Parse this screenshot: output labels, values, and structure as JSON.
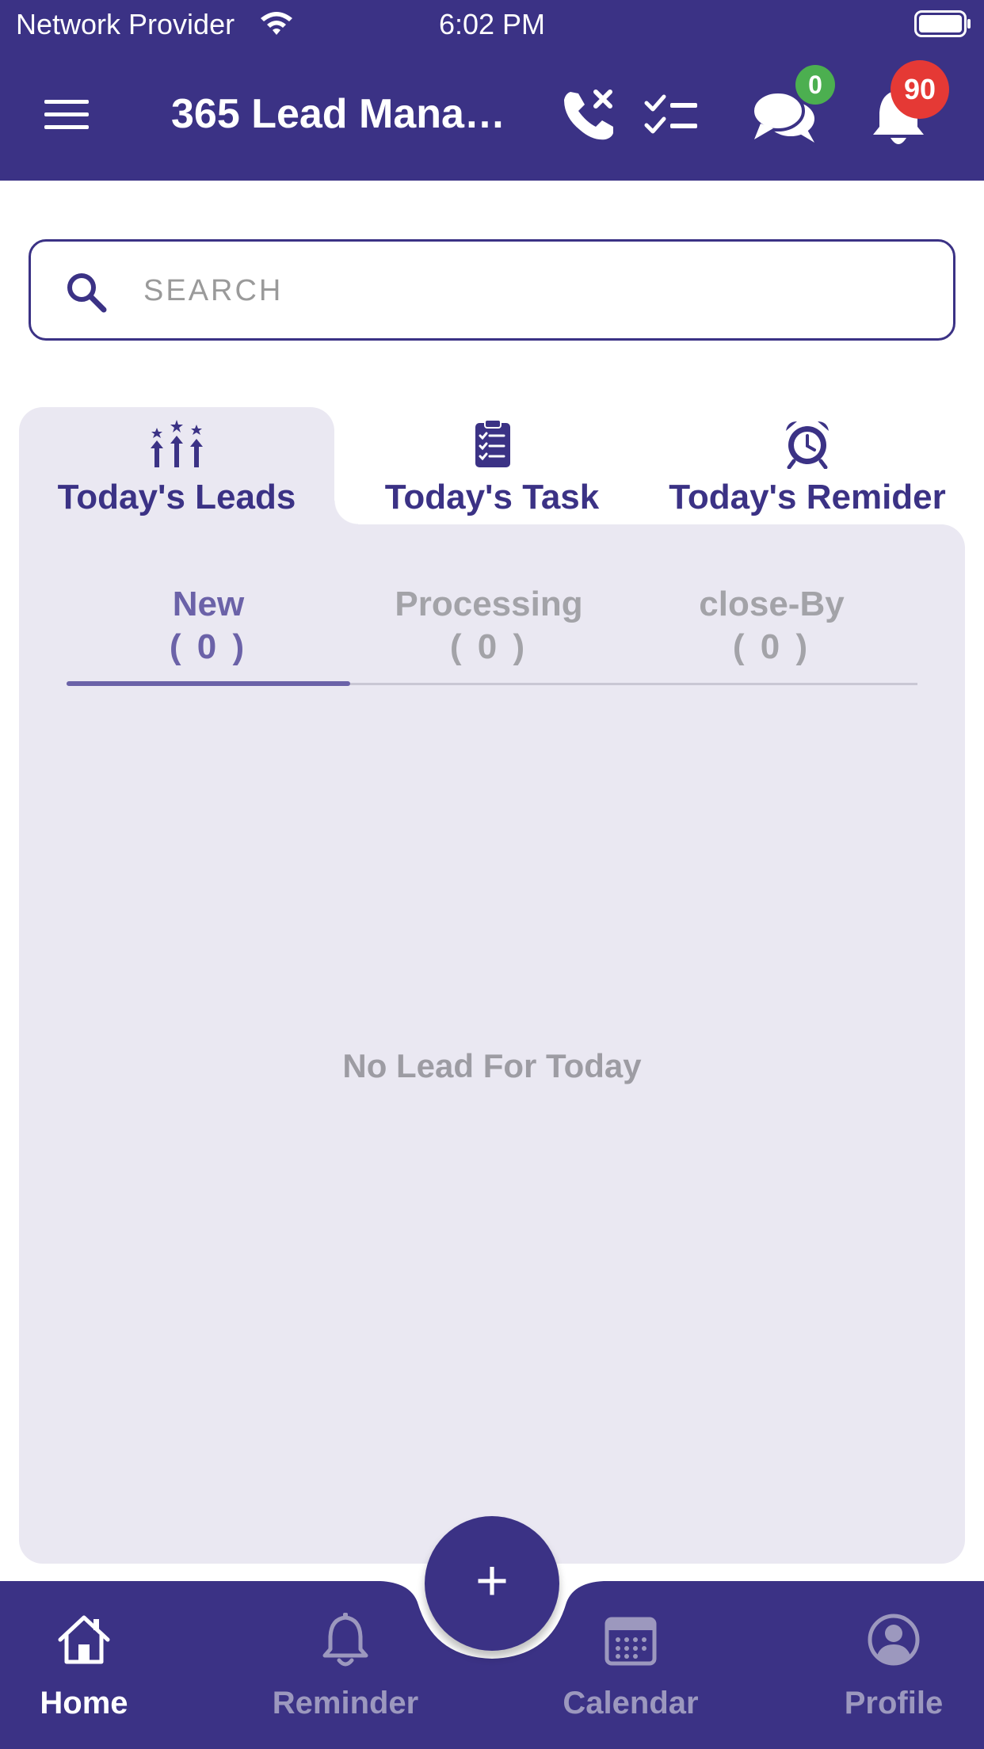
{
  "status_bar": {
    "carrier": "Network Provider",
    "time": "6:02 PM"
  },
  "app_bar": {
    "title": "365 Lead Mana…",
    "chat_badge": "0",
    "notification_badge": "90"
  },
  "search": {
    "placeholder": "SEARCH"
  },
  "main_tabs": [
    {
      "label": "Today's Leads",
      "icon": "leads-growth-icon",
      "selected": true
    },
    {
      "label": "Today's Task",
      "icon": "clipboard-checklist-icon",
      "selected": false
    },
    {
      "label": "Today's Remider",
      "icon": "alarm-clock-icon",
      "selected": false
    }
  ],
  "sub_tabs": [
    {
      "label": "New",
      "count": "( 0 )",
      "selected": true
    },
    {
      "label": "Processing",
      "count": "( 0 )",
      "selected": false
    },
    {
      "label": "close-By",
      "count": "( 0 )",
      "selected": false
    }
  ],
  "empty_message": "No Lead For Today",
  "bottom_nav": [
    {
      "label": "Home",
      "icon": "home-icon",
      "active": true
    },
    {
      "label": "Reminder",
      "icon": "bell-outline-icon",
      "active": false
    },
    {
      "label": "Calendar",
      "icon": "calendar-icon",
      "active": false
    },
    {
      "label": "Profile",
      "icon": "user-circle-icon",
      "active": false
    }
  ],
  "fab": {
    "icon": "plus-icon",
    "symbol": "+"
  },
  "colors": {
    "primary": "#3b3285",
    "panel_background": "#eae8f2",
    "accent_subtab": "#6b62a8",
    "inactive_text": "#a3a3a8",
    "badge_green": "#4caf50",
    "badge_red": "#e53935"
  }
}
